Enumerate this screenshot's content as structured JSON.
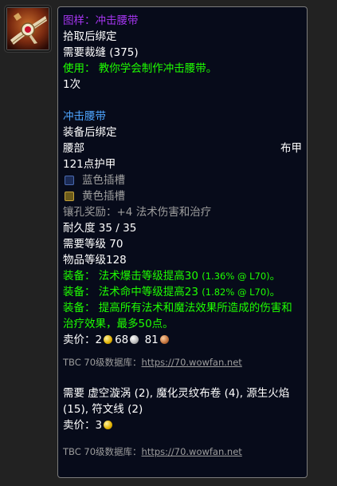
{
  "icon": {
    "name": "belt-item-icon"
  },
  "pattern": {
    "title": "图样：冲击腰带",
    "bind": "拾取后绑定",
    "requires_skill": "需要裁缝 (375)",
    "use_label": "使用：",
    "use_text": "教你学会制作冲击腰带。",
    "charges": "1次"
  },
  "item": {
    "name": "冲击腰带",
    "bind": "装备后绑定",
    "slot": "腰部",
    "armor_type": "布甲",
    "armor": "121点护甲",
    "sockets": [
      {
        "color": "blue",
        "label": "蓝色插槽"
      },
      {
        "color": "yellow",
        "label": "黄色插槽"
      }
    ],
    "socket_bonus": "镶孔奖励：+4 法术伤害和治疗",
    "durability": "耐久度 35 / 35",
    "required_level": "需要等级 70",
    "item_level": "物品等级128",
    "equip_lines": [
      {
        "label": "装备：",
        "text": "法术爆击等级提高30",
        "note": "(1.36% @ L70)",
        "tail": "。"
      },
      {
        "label": "装备：",
        "text": "法术命中等级提高23",
        "note": "(1.82% @ L70)",
        "tail": "。"
      }
    ],
    "equip_long_label": "装备：",
    "equip_long_text": "提高所有法术和魔法效果所造成的伤害和治疗效果，最多50点。",
    "sell_label": "卖价：",
    "sell_gold": "2",
    "sell_silver": "68",
    "sell_copper": "81"
  },
  "database": {
    "label": "TBC 70级数据库：",
    "url": "https://70.wowfan.net"
  },
  "reagents": {
    "text": "需要 虚空漩涡 (2), 魔化灵纹布卷 (4), 源生火焰 (15), 符文线 (2)",
    "sell_label": "卖价：",
    "sell_gold": "3"
  },
  "database2": {
    "label": "TBC 70级数据库：",
    "url": "https://70.wowfan.net"
  }
}
